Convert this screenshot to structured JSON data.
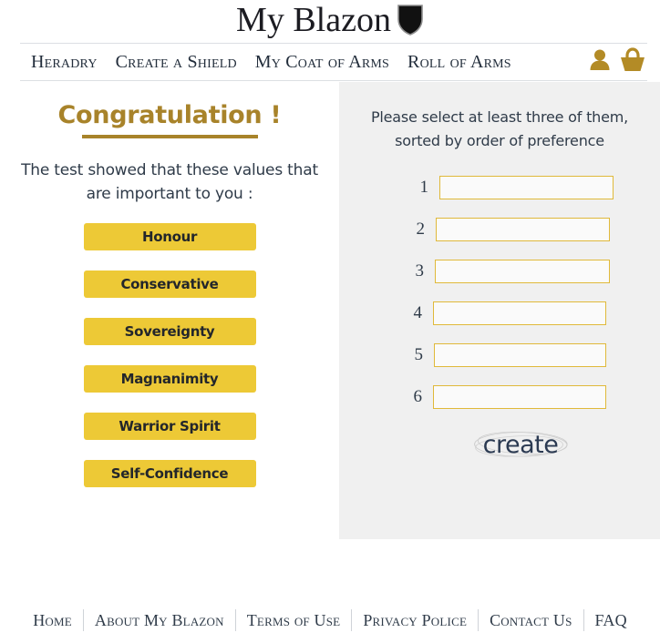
{
  "header": {
    "brand": "My Blazon",
    "shield_icon": "shield-icon"
  },
  "nav": {
    "items": [
      {
        "label": "Heradry"
      },
      {
        "label": "Create a Shield"
      },
      {
        "label": "My Coat of Arms"
      },
      {
        "label": "Roll of Arms"
      }
    ],
    "icons": [
      {
        "name": "account-icon"
      },
      {
        "name": "basket-icon"
      }
    ]
  },
  "left": {
    "heading": "Congratulation !",
    "lead": "The test showed that these values that are important to you :",
    "values": [
      {
        "label": "Honour"
      },
      {
        "label": "Conservative"
      },
      {
        "label": "Sovereignty"
      },
      {
        "label": "Magnanimity"
      },
      {
        "label": "Warrior Spirit"
      },
      {
        "label": "Self-Confidence"
      }
    ]
  },
  "right": {
    "instruction": "Please select at least three of them, sorted by order of preference",
    "rows": [
      {
        "number": "1",
        "value": "",
        "placeholder": ""
      },
      {
        "number": "2",
        "value": "",
        "placeholder": ""
      },
      {
        "number": "3",
        "value": "",
        "placeholder": ""
      },
      {
        "number": "4",
        "value": "",
        "placeholder": ""
      },
      {
        "number": "5",
        "value": "",
        "placeholder": ""
      },
      {
        "number": "6",
        "value": "",
        "placeholder": ""
      }
    ],
    "create_label": "create"
  },
  "footer": {
    "links": [
      {
        "label": "Home"
      },
      {
        "label": "About My Blazon"
      },
      {
        "label": "Terms of Use"
      },
      {
        "label": "Privacy Police"
      },
      {
        "label": "Contact Us"
      },
      {
        "label": "FAQ"
      }
    ]
  },
  "colors": {
    "gold_dark": "#a8832a",
    "yellow": "#edc936",
    "input_border": "#e0b93a",
    "panel_bg": "#f0f0f0",
    "text_dark": "#2f3b49",
    "icon_gold": "#b38b26"
  }
}
